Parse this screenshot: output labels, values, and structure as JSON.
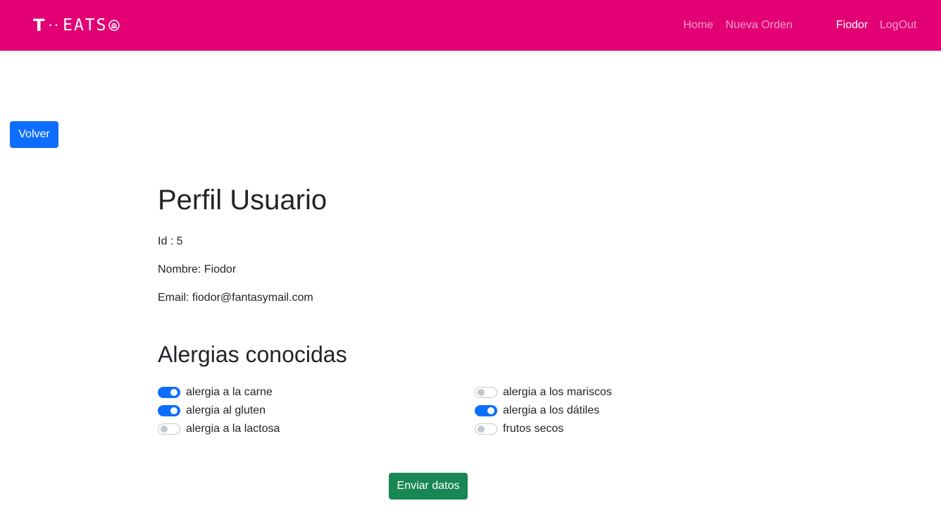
{
  "navbar": {
    "brand_t": "T",
    "brand_dots": "··",
    "brand_text": "EATS",
    "brand_icon": "burger-icon",
    "links": {
      "home": "Home",
      "nueva_orden": "Nueva Orden",
      "user": "Fiodor",
      "logout": "LogOut"
    },
    "color": "#e20074"
  },
  "actions": {
    "back_label": "Volver",
    "submit_label": "Enviar datos"
  },
  "profile": {
    "title": "Perfil Usuario",
    "id_line": "Id : 5",
    "name_line": "Nombre: Fiodor",
    "email_line": "Email: fiodor@fantasymail.com"
  },
  "allergies": {
    "title": "Alergias conocidas",
    "items": [
      {
        "label": "alergia a la carne",
        "checked": true
      },
      {
        "label": "alergia al gluten",
        "checked": true
      },
      {
        "label": "alergia a la lactosa",
        "checked": false
      },
      {
        "label": "alergia a los mariscos",
        "checked": false
      },
      {
        "label": "alergia a los dátiles",
        "checked": true
      },
      {
        "label": "frutos secos",
        "checked": false
      }
    ]
  },
  "colors": {
    "primary": "#0d6efd",
    "success": "#198754",
    "brand": "#e20074"
  }
}
